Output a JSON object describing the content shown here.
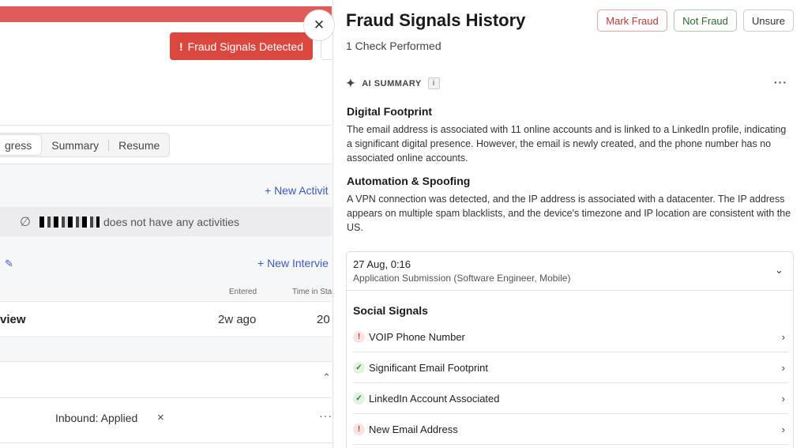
{
  "background": {
    "fraud_button": {
      "icon": "!",
      "label": "Fraud Signals Detected"
    },
    "tabs": [
      {
        "label": "gress"
      },
      {
        "label": "Summary"
      },
      {
        "label": "Resume"
      }
    ],
    "new_activity_label": "+ New Activit",
    "no_activities_text": "does not have any activities",
    "new_interview_label": "+ New Intervie",
    "columns": {
      "entered": "Entered",
      "time_in_stage": "Time in Stag"
    },
    "interview_row": {
      "name": "view",
      "entered": "2w ago",
      "time": "20"
    },
    "inbound_label": "Inbound: Applied",
    "remove_icon": "×",
    "more_icon": "···",
    "slash_icon": "∅",
    "pencil_icon": "✎",
    "chevron_up": "⌃"
  },
  "panel": {
    "title": "Fraud Signals History",
    "subtitle": "1 Check Performed",
    "close_icon": "✕",
    "actions": {
      "mark_fraud": "Mark Fraud",
      "not_fraud": "Not Fraud",
      "unsure": "Unsure"
    },
    "ai_summary": {
      "label": "AI SUMMARY",
      "info": "i",
      "more": "···",
      "spark": "✦"
    },
    "sections": [
      {
        "heading": "Digital Footprint",
        "text": "The email address is associated with 11 online accounts and is linked to a LinkedIn profile, indicating a significant digital presence. However, the email is newly created, and the phone number has no associated online accounts."
      },
      {
        "heading": "Automation & Spoofing",
        "text": "A VPN connection was detected, and the IP address is associated with a datacenter. The IP address appears on multiple spam blacklists, and the device's timezone and IP location are consistent with the US."
      }
    ],
    "check": {
      "date": "27 Aug, 0:16",
      "application": "Application Submission (Software Engineer, Mobile)",
      "social_title": "Social Signals",
      "signals": [
        {
          "label": "VOIP Phone Number",
          "status": "warning",
          "icon": "!"
        },
        {
          "label": "Significant Email Footprint",
          "status": "ok",
          "icon": "✓"
        },
        {
          "label": "LinkedIn Account Associated",
          "status": "ok",
          "icon": "✓"
        },
        {
          "label": "New Email Address",
          "status": "warning",
          "icon": "!"
        }
      ]
    }
  },
  "colors": {
    "danger": "#d9473f",
    "link": "#3b5bbf",
    "success": "#2f6b2d"
  }
}
